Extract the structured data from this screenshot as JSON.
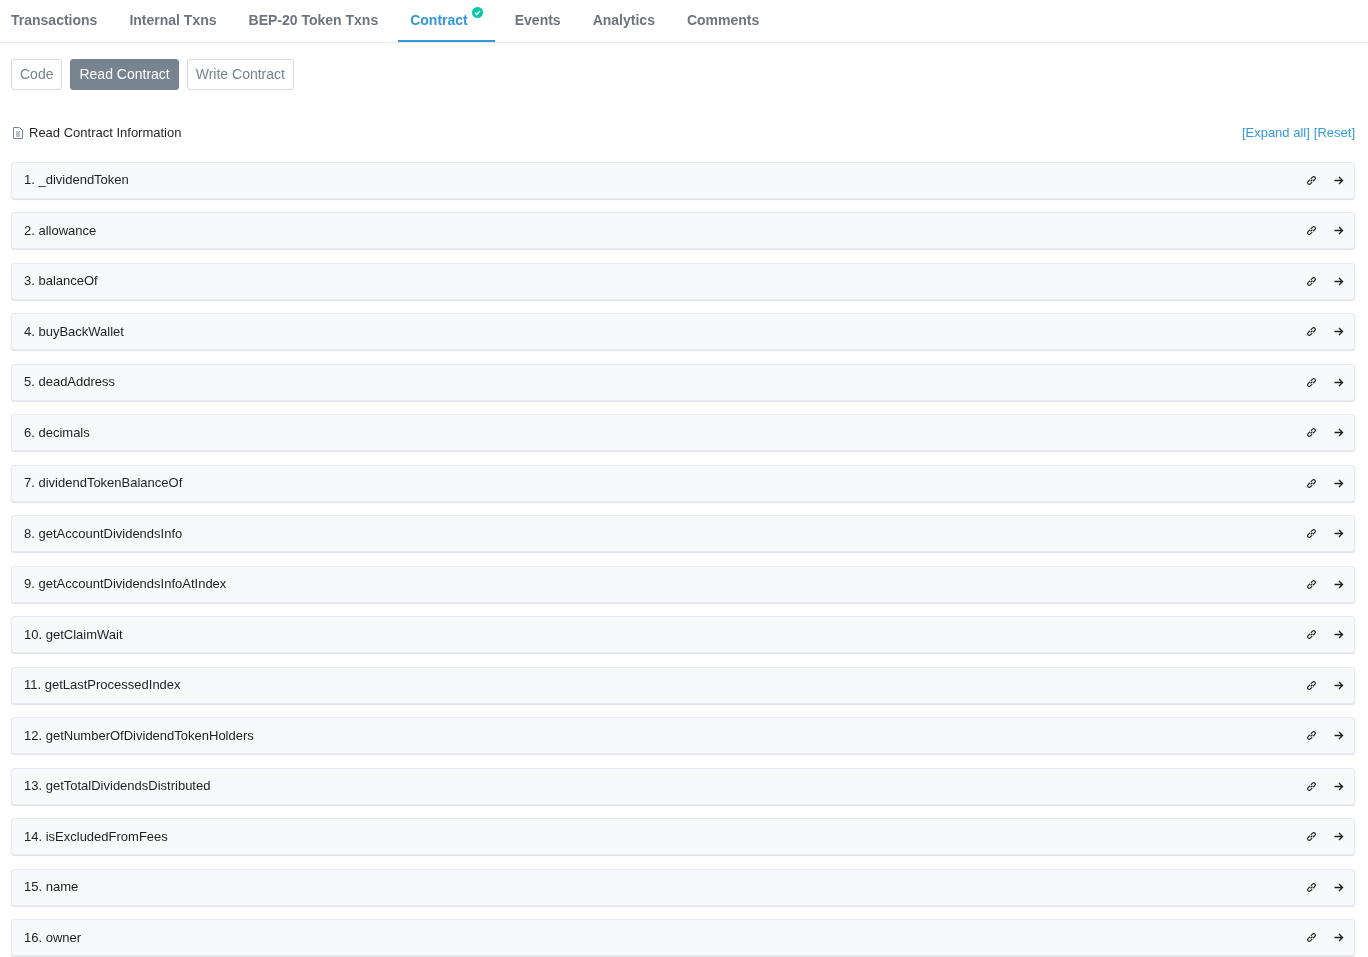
{
  "tabs": [
    {
      "label": "Transactions",
      "selected": false,
      "verified": false
    },
    {
      "label": "Internal Txns",
      "selected": false,
      "verified": false
    },
    {
      "label": "BEP-20 Token Txns",
      "selected": false,
      "verified": false
    },
    {
      "label": "Contract",
      "selected": true,
      "verified": true
    },
    {
      "label": "Events",
      "selected": false,
      "verified": false
    },
    {
      "label": "Analytics",
      "selected": false,
      "verified": false
    },
    {
      "label": "Comments",
      "selected": false,
      "verified": false
    }
  ],
  "sub_tabs": [
    {
      "label": "Code",
      "selected": false
    },
    {
      "label": "Read Contract",
      "selected": true
    },
    {
      "label": "Write Contract",
      "selected": false
    }
  ],
  "section": {
    "title": "Read Contract Information",
    "links": [
      "[Expand all]",
      "[Reset]"
    ]
  },
  "functions": [
    "1. _dividendToken",
    "2. allowance",
    "3. balanceOf",
    "4. buyBackWallet",
    "5. deadAddress",
    "6. decimals",
    "7. dividendTokenBalanceOf",
    "8. getAccountDividendsInfo",
    "9. getAccountDividendsInfoAtIndex",
    "10. getClaimWait",
    "11. getLastProcessedIndex",
    "12. getNumberOfDividendTokenHolders",
    "13. getTotalDividendsDistributed",
    "14. isExcludedFromFees",
    "15. name",
    "16. owner"
  ]
}
